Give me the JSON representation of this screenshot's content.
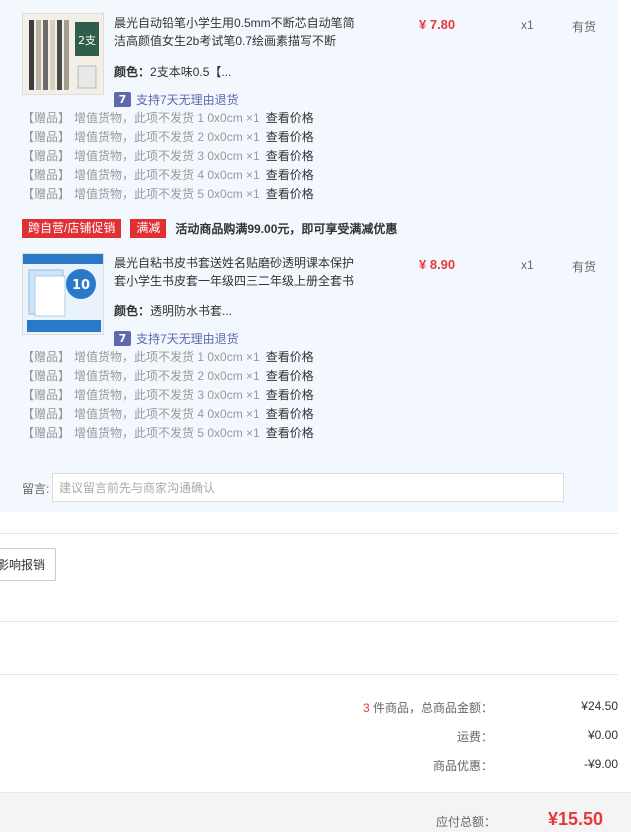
{
  "products": [
    {
      "name": "晨光自动铅笔小学生用0.5mm不断芯自动笔简洁高颜值女生2b考试笔0.7绘画素描写不断",
      "price": "¥ 7.80",
      "qty": "x1",
      "stock": "有货",
      "attr_label": "颜色：",
      "attr_value": "2支本味0.5【...",
      "return_icon": "7",
      "return_text": "支持7天无理由退货",
      "thumb_badge": "2支",
      "gifts": [
        {
          "tag": "【赠品】",
          "text": "增值货物，此项不发货 1 0x0cm ×1",
          "link": "查看价格"
        },
        {
          "tag": "【赠品】",
          "text": "增值货物，此项不发货 2 0x0cm ×1",
          "link": "查看价格"
        },
        {
          "tag": "【赠品】",
          "text": "增值货物，此项不发货 3 0x0cm ×1",
          "link": "查看价格"
        },
        {
          "tag": "【赠品】",
          "text": "增值货物，此项不发货 4 0x0cm ×1",
          "link": "查看价格"
        },
        {
          "tag": "【赠品】",
          "text": "增值货物，此项不发货 5 0x0cm ×1",
          "link": "查看价格"
        }
      ]
    },
    {
      "name": "晨光自粘书皮书套送姓名贴磨砂透明课本保护套小学生书皮套一年级四三二年级上册全套书",
      "price": "¥ 8.90",
      "qty": "x1",
      "stock": "有货",
      "attr_label": "颜色：",
      "attr_value": "透明防水书套...",
      "return_icon": "7",
      "return_text": "支持7天无理由退货",
      "thumb_badge": "10",
      "gifts": [
        {
          "tag": "【赠品】",
          "text": "增值货物，此项不发货 1 0x0cm ×1",
          "link": "查看价格"
        },
        {
          "tag": "【赠品】",
          "text": "增值货物，此项不发货 2 0x0cm ×1",
          "link": "查看价格"
        },
        {
          "tag": "【赠品】",
          "text": "增值货物，此项不发货 3 0x0cm ×1",
          "link": "查看价格"
        },
        {
          "tag": "【赠品】",
          "text": "增值货物，此项不发货 4 0x0cm ×1",
          "link": "查看价格"
        },
        {
          "tag": "【赠品】",
          "text": "增值货物，此项不发货 5 0x0cm ×1",
          "link": "查看价格"
        }
      ]
    }
  ],
  "promo": {
    "tag1": "跨自营/店铺促销",
    "tag2": "满减",
    "text": "活动商品购满99.00元，即可享受满减优惠"
  },
  "memo": {
    "label": "留言:",
    "placeholder": "建议留言前先与商家沟通确认"
  },
  "invoice": {
    "button_label": "影响报销"
  },
  "summary": {
    "count": "3",
    "count_suffix": " 件商品，总商品金额：",
    "goods_amount": "¥24.50",
    "shipping_label": "运费：",
    "shipping": "¥0.00",
    "discount_label": "商品优惠：",
    "discount": "-¥9.00",
    "total_label": "应付总额：",
    "total": "¥15.50"
  },
  "colors": {
    "accent_red": "#e4393c",
    "panel_bg": "#f3f8fe",
    "return_blue": "#5e69ad"
  }
}
